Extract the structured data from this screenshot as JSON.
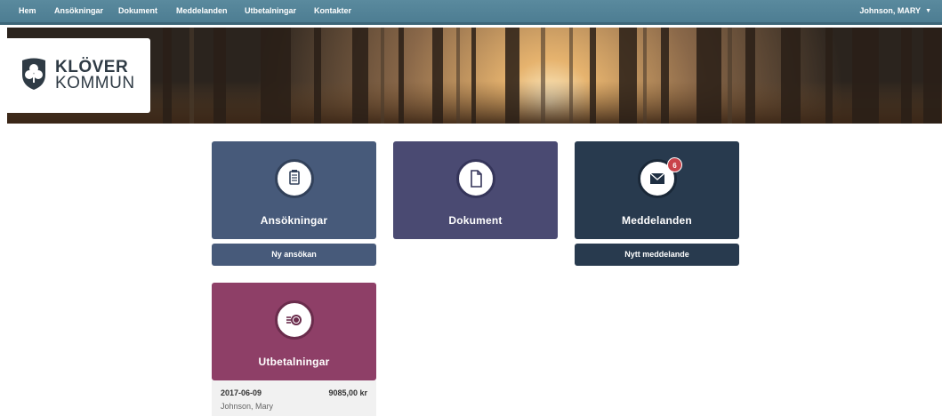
{
  "nav": {
    "items": [
      "Hem",
      "Ansökningar",
      "Dokument",
      "Meddelanden",
      "Utbetalningar",
      "Kontakter"
    ],
    "user": "Johnson, MARY"
  },
  "logo": {
    "line1": "KLÖVER",
    "line2": "KOMMUN"
  },
  "tiles": {
    "applications": {
      "label": "Ansökningar",
      "button": "Ny ansökan",
      "color": "#475a7a",
      "icon": "clipboard-icon"
    },
    "documents": {
      "label": "Dokument",
      "color": "#4a4a72",
      "icon": "document-icon"
    },
    "messages": {
      "label": "Meddelanden",
      "button": "Nytt meddelande",
      "badge": "6",
      "color": "#283a4e",
      "icon": "envelope-icon"
    },
    "payments": {
      "label": "Utbetalningar",
      "color": "#8e3f67",
      "icon": "coins-icon",
      "latest": {
        "date": "2017-06-09",
        "amount": "9085,00 kr",
        "name": "Johnson, Mary"
      }
    }
  }
}
